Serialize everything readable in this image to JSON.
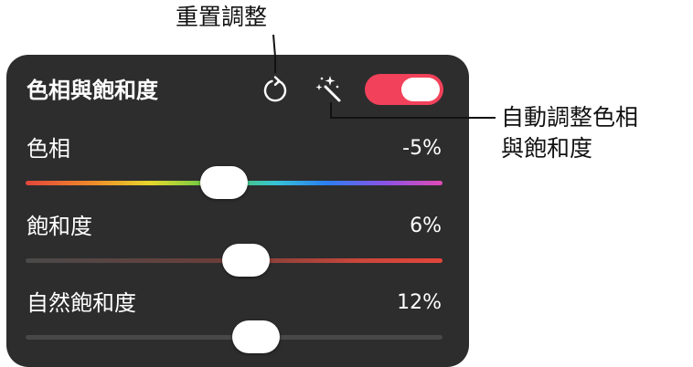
{
  "callouts": {
    "reset": "重置調整",
    "auto_line1": "自動調整色相",
    "auto_line2": "與飽和度"
  },
  "panel": {
    "title": "色相與飽和度",
    "toggle_on": true,
    "accent_color": "#f2415a",
    "icons": {
      "reset": "reset-arrow-icon",
      "auto": "magic-wand-icon"
    }
  },
  "sliders": [
    {
      "label": "色相",
      "value_text": "-5%",
      "value": -5
    },
    {
      "label": "飽和度",
      "value_text": "6%",
      "value": 6
    },
    {
      "label": "自然飽和度",
      "value_text": "12%",
      "value": 12
    }
  ]
}
